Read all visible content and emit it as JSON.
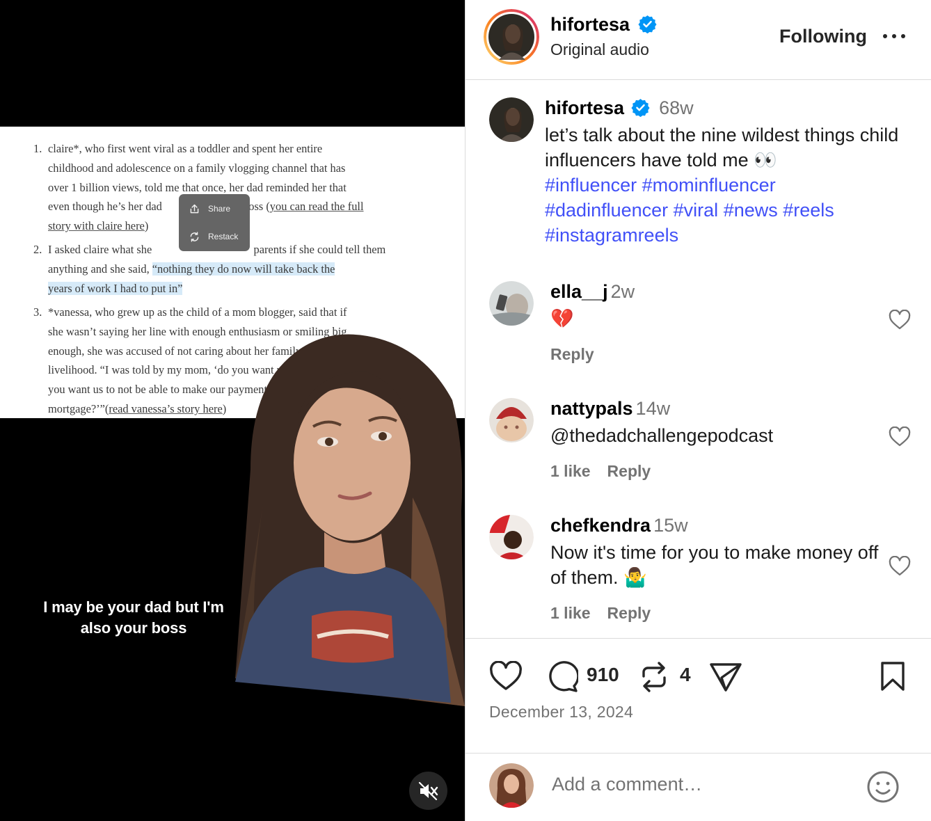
{
  "video": {
    "article": {
      "items": [
        {
          "num": "1.",
          "lines": [
            "claire*, who first went viral as a toddler and spent her entire",
            "childhood and adolescence on a family vlogging channel that has",
            "over 1 billion views, told me that once, her dad reminded her that"
          ],
          "line4_start": "even though he’s her dad",
          "line4_end": "boss (",
          "link_part1": "you can read the full",
          "link_part2": "story with claire here",
          "link_close": ")"
        },
        {
          "num": "2.",
          "line1_start": "I asked claire what she",
          "line1_end": "parents if she could tell them",
          "line2_start": "anything and she said, ",
          "quote_part1": "“nothing they do now will take back the",
          "quote_part2": "years of work I had to put in”"
        },
        {
          "num": "3.",
          "lines": [
            "*vanessa, who grew up as the child of a mom blogger, said that if",
            "she wasn’t saying her line with enough enthusiasm or smiling big",
            "enough, she was accused of not caring about her family’s",
            "livelihood. “I was told by my mom, ‘do you want us to",
            "you want us to not be able to make our payment next"
          ],
          "last_start": "mortgage?’”(",
          "last_link": "read vanessa’s story here",
          "last_close": ")"
        }
      ]
    },
    "popup": {
      "share_label": "Share",
      "restack_label": "Restack"
    },
    "caption": "I may be your dad but I'm also your boss",
    "mute_icon": "speaker-muted-icon"
  },
  "header": {
    "username": "hifortesa",
    "audio": "Original audio",
    "follow_label": "Following",
    "more_icon": "more-horizontal-icon"
  },
  "post_caption": {
    "username": "hifortesa",
    "time": "68w",
    "text": "let’s talk about the nine wildest things child influencers have told me 👀",
    "hashtags": [
      "#influencer",
      "#mominfluencer",
      "#dadinfluencer",
      "#viral",
      "#news",
      "#reels",
      "#instagramreels"
    ]
  },
  "comments": [
    {
      "username": "ella__j",
      "time": "2w",
      "text": "💔",
      "likes": "",
      "reply_label": "Reply"
    },
    {
      "username": "nattypals",
      "time": "14w",
      "text": "@thedadchallengepodcast",
      "likes": "1 like",
      "reply_label": "Reply"
    },
    {
      "username": "chefkendra",
      "time": "15w",
      "text": "Now it's time for you to make money off of them. 🤷‍♂️",
      "likes": "1 like",
      "reply_label": "Reply"
    }
  ],
  "actions": {
    "comment_count": "910",
    "repost_count": "4",
    "date": "December 13, 2024"
  },
  "comment_box": {
    "placeholder": "Add a comment…"
  },
  "colors": {
    "link_blue": "#4150f7",
    "verified_blue": "#0095f6",
    "muted_gray": "#737373",
    "highlight": "#d6eaf8",
    "story_ring_start": "#feda75",
    "story_ring_end": "#d62976"
  }
}
